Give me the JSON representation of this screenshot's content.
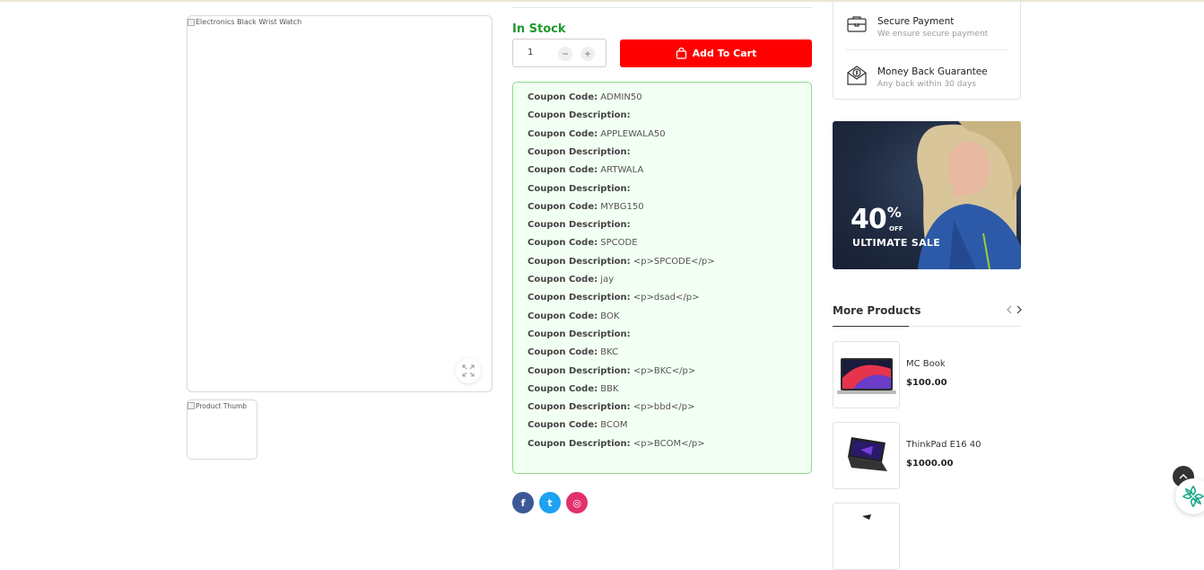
{
  "gallery": {
    "main_alt": "Electronics Black Wrist Watch",
    "thumb_alt": "Product Thumb"
  },
  "purchase": {
    "stock_status": "In Stock",
    "quantity": "1",
    "add_to_cart_label": "Add To Cart",
    "colors": {
      "stock": "#1b9a2d",
      "cart_button": "#ff0000"
    }
  },
  "coupons": {
    "code_label": "Coupon Code:",
    "description_label": "Coupon Description:",
    "items": [
      {
        "code": "ADMIN50",
        "description": ""
      },
      {
        "code": "APPLEWALA50",
        "description": ""
      },
      {
        "code": "ARTWALA",
        "description": ""
      },
      {
        "code": "MYBG150",
        "description": ""
      },
      {
        "code": "SPCODE",
        "description": "<p>SPCODE</p>"
      },
      {
        "code": "jay",
        "description": "<p>dsad</p>"
      },
      {
        "code": "BOK",
        "description": ""
      },
      {
        "code": "BKC",
        "description": "<p>BKC</p>"
      },
      {
        "code": "BBK",
        "description": "<p>bbd</p>"
      },
      {
        "code": "BCOM",
        "description": "<p>BCOM</p>"
      }
    ]
  },
  "social": {
    "items": [
      {
        "icon": "facebook-icon",
        "glyph": "f",
        "color": "#3b5998"
      },
      {
        "icon": "twitter-icon",
        "glyph": "t",
        "color": "#1da1f2"
      },
      {
        "icon": "instagram-icon",
        "glyph": "◎",
        "color": "#e1306c"
      }
    ]
  },
  "features": [
    {
      "icon": "briefcase-icon",
      "title": "Secure Payment",
      "subtitle": "We ensure secure payment"
    },
    {
      "icon": "money-envelope-icon",
      "title": "Money Back Guarantee",
      "subtitle": "Any back within 30 days"
    }
  ],
  "banner": {
    "percent": "40",
    "percent_sign": "%",
    "off": "OFF",
    "title": "ULTIMATE SALE"
  },
  "more_products": {
    "title": "More Products",
    "items": [
      {
        "name": "MC Book",
        "price": "$100.00"
      },
      {
        "name": "ThinkPad E16 40",
        "price": "$1000.00"
      }
    ]
  }
}
